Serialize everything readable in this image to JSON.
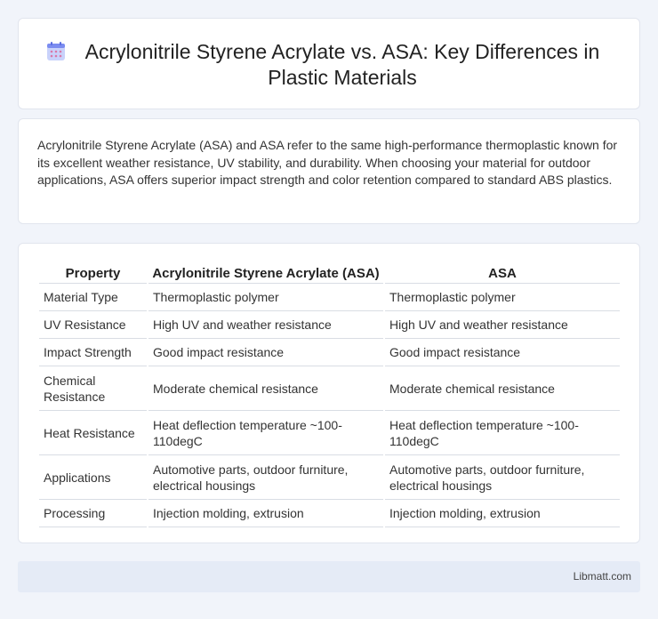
{
  "header": {
    "title": "Acrylonitrile Styrene Acrylate vs. ASA: Key Differences in Plastic Materials",
    "icon": "calendar-icon"
  },
  "intro": {
    "text": "Acrylonitrile Styrene Acrylate (ASA) and ASA refer to the same high-performance thermoplastic known for its excellent weather resistance, UV stability, and durability. When choosing your material for outdoor applications, ASA offers superior impact strength and color retention compared to standard ABS plastics."
  },
  "table": {
    "headers": [
      "Property",
      "Acrylonitrile Styrene Acrylate (ASA)",
      "ASA"
    ],
    "rows": [
      [
        "Material Type",
        "Thermoplastic polymer",
        "Thermoplastic polymer"
      ],
      [
        "UV Resistance",
        "High UV and weather resistance",
        "High UV and weather resistance"
      ],
      [
        "Impact Strength",
        "Good impact resistance",
        "Good impact resistance"
      ],
      [
        "Chemical Resistance",
        "Moderate chemical resistance",
        "Moderate chemical resistance"
      ],
      [
        "Heat Resistance",
        "Heat deflection temperature ~100-110degC",
        "Heat deflection temperature ~100-110degC"
      ],
      [
        "Applications",
        "Automotive parts, outdoor furniture, electrical housings",
        "Automotive parts, outdoor furniture, electrical housings"
      ],
      [
        "Processing",
        "Injection molding, extrusion",
        "Injection molding, extrusion"
      ]
    ]
  },
  "footer": {
    "site": "Libmatt.com"
  },
  "colors": {
    "background": "#f1f4fa",
    "card": "#ffffff",
    "footer": "#e5ebf6",
    "icon_accent": "#7b8cf0"
  }
}
